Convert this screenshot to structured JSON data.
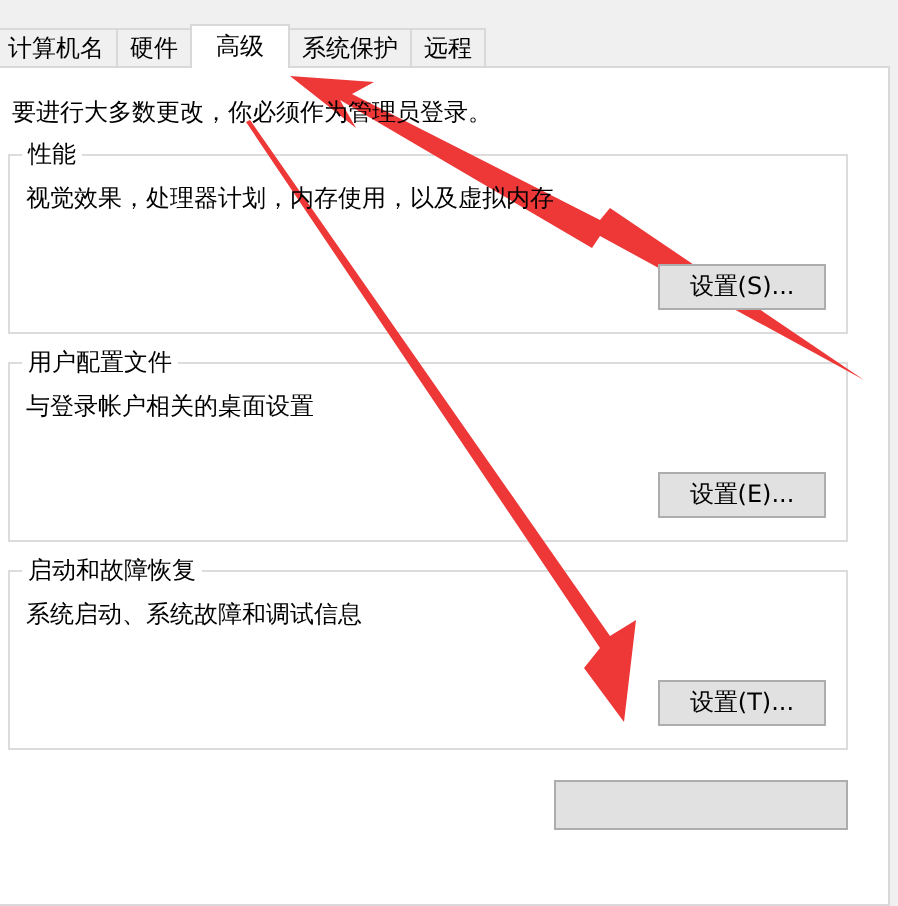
{
  "tabs": [
    {
      "label": "计算机名",
      "selected": false
    },
    {
      "label": "硬件",
      "selected": false
    },
    {
      "label": "高级",
      "selected": true
    },
    {
      "label": "系统保护",
      "selected": false
    },
    {
      "label": "远程",
      "selected": false
    }
  ],
  "notice": "要进行大多数更改，你必须作为管理员登录。",
  "groups": [
    {
      "title": "性能",
      "description": "视觉效果，处理器计划，内存使用，以及虚拟内存",
      "button": "设置(S)..."
    },
    {
      "title": "用户配置文件",
      "description": "与登录帐户相关的桌面设置",
      "button": "设置(E)..."
    },
    {
      "title": "启动和故障恢复",
      "description": "系统启动、系统故障和调试信息",
      "button": "设置(T)..."
    }
  ]
}
